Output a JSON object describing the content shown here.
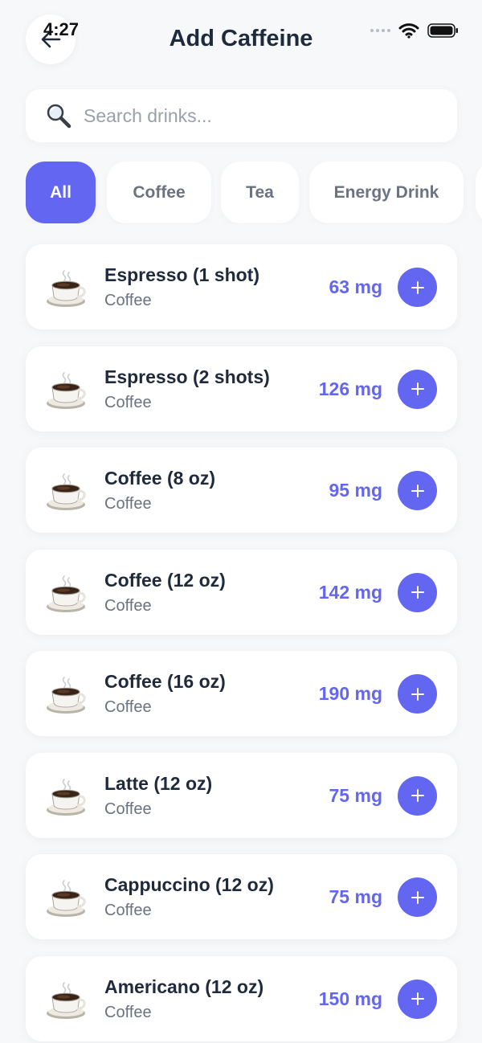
{
  "status_bar": {
    "time": "4:27"
  },
  "header": {
    "title": "Add Caffeine"
  },
  "search": {
    "placeholder": "Search drinks...",
    "value": ""
  },
  "filters": [
    {
      "label": "All",
      "active": true
    },
    {
      "label": "Coffee",
      "active": false
    },
    {
      "label": "Tea",
      "active": false
    },
    {
      "label": "Energy Drink",
      "active": false
    }
  ],
  "drinks": [
    {
      "name": "Espresso (1 shot)",
      "category": "Coffee",
      "caffeine": "63 mg",
      "icon": "coffee-cup-icon"
    },
    {
      "name": "Espresso (2 shots)",
      "category": "Coffee",
      "caffeine": "126 mg",
      "icon": "coffee-cup-icon"
    },
    {
      "name": "Coffee (8 oz)",
      "category": "Coffee",
      "caffeine": "95 mg",
      "icon": "coffee-cup-icon"
    },
    {
      "name": "Coffee (12 oz)",
      "category": "Coffee",
      "caffeine": "142 mg",
      "icon": "coffee-cup-icon"
    },
    {
      "name": "Coffee (16 oz)",
      "category": "Coffee",
      "caffeine": "190 mg",
      "icon": "coffee-cup-icon"
    },
    {
      "name": "Latte (12 oz)",
      "category": "Coffee",
      "caffeine": "75 mg",
      "icon": "coffee-cup-icon"
    },
    {
      "name": "Cappuccino (12 oz)",
      "category": "Coffee",
      "caffeine": "75 mg",
      "icon": "coffee-cup-icon"
    },
    {
      "name": "Americano (12 oz)",
      "category": "Coffee",
      "caffeine": "150 mg",
      "icon": "coffee-cup-icon"
    }
  ],
  "colors": {
    "accent": "#6366f1",
    "background": "#f7f8fa",
    "card": "#ffffff",
    "muted_text": "#6b7280"
  }
}
